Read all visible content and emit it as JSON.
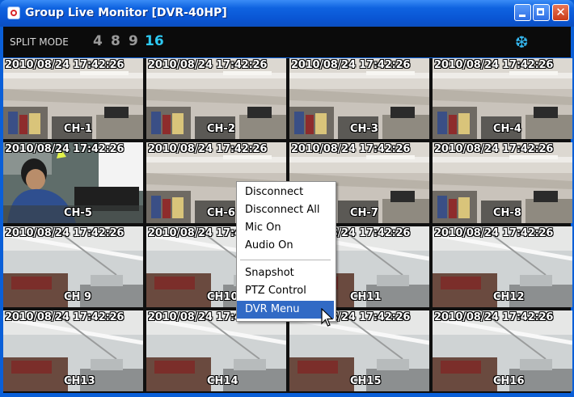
{
  "window": {
    "title": "Group Live Monitor [DVR-40HP]",
    "buttons": {
      "minimize_icon": "minimize-icon",
      "maximize_icon": "maximize-icon",
      "close_icon": "close-icon",
      "close_glyph": "✕"
    },
    "accent": "#0a5fd8"
  },
  "toolbar": {
    "split_label": "SPLIT MODE",
    "split_options": [
      "4",
      "8",
      "9",
      "16"
    ],
    "active_split": "16",
    "settings_icon": "snowflake-icon",
    "settings_glyph": "❆"
  },
  "cameras": [
    {
      "ch": "CH-1",
      "time": "2010/08/24 17:42:26",
      "scene": "office"
    },
    {
      "ch": "CH-2",
      "time": "2010/08/24 17:42:26",
      "scene": "office"
    },
    {
      "ch": "CH-3",
      "time": "2010/08/24 17:42:26",
      "scene": "office"
    },
    {
      "ch": "CH-4",
      "time": "2010/08/24 17:42:26",
      "scene": "office"
    },
    {
      "ch": "CH-5",
      "time": "2010/08/24 17:42:26",
      "scene": "person"
    },
    {
      "ch": "CH-6",
      "time": "2010/08/24 17:42:26",
      "scene": "office"
    },
    {
      "ch": "CH-7",
      "time": "2010/08/24 17:42:26",
      "scene": "office"
    },
    {
      "ch": "CH-8",
      "time": "2010/08/24 17:42:26",
      "scene": "office"
    },
    {
      "ch": "CH 9",
      "time": "2010/08/24 17:42:26",
      "scene": "lamp"
    },
    {
      "ch": "CH10",
      "time": "2010/08/24 17:42:26",
      "scene": "lamp"
    },
    {
      "ch": "CH11",
      "time": "2010/08/24 17:42:26",
      "scene": "lamp"
    },
    {
      "ch": "CH12",
      "time": "2010/08/24 17:42:26",
      "scene": "lamp"
    },
    {
      "ch": "CH13",
      "time": "2010/08/24 17:42:26",
      "scene": "lamp"
    },
    {
      "ch": "CH14",
      "time": "2010/08/24 17:42:26",
      "scene": "lamp"
    },
    {
      "ch": "CH15",
      "time": "2010/08/24 17:42:26",
      "scene": "lamp"
    },
    {
      "ch": "CH16",
      "time": "2010/08/24 17:42:26",
      "scene": "lamp"
    }
  ],
  "context_menu": {
    "items": [
      {
        "label": "Disconnect",
        "mnemonic": "D"
      },
      {
        "label": "Disconnect All",
        "mnemonic": "A"
      },
      {
        "label": "Mic On",
        "mnemonic": "M"
      },
      {
        "label": "Audio On",
        "mnemonic": "u"
      },
      {
        "label": "Snapshot",
        "mnemonic": "S"
      },
      {
        "label": "PTZ Control",
        "mnemonic": "P"
      },
      {
        "label": "DVR Menu",
        "mnemonic": "V",
        "highlighted": true
      }
    ],
    "highlight_color": "#316ac5"
  }
}
